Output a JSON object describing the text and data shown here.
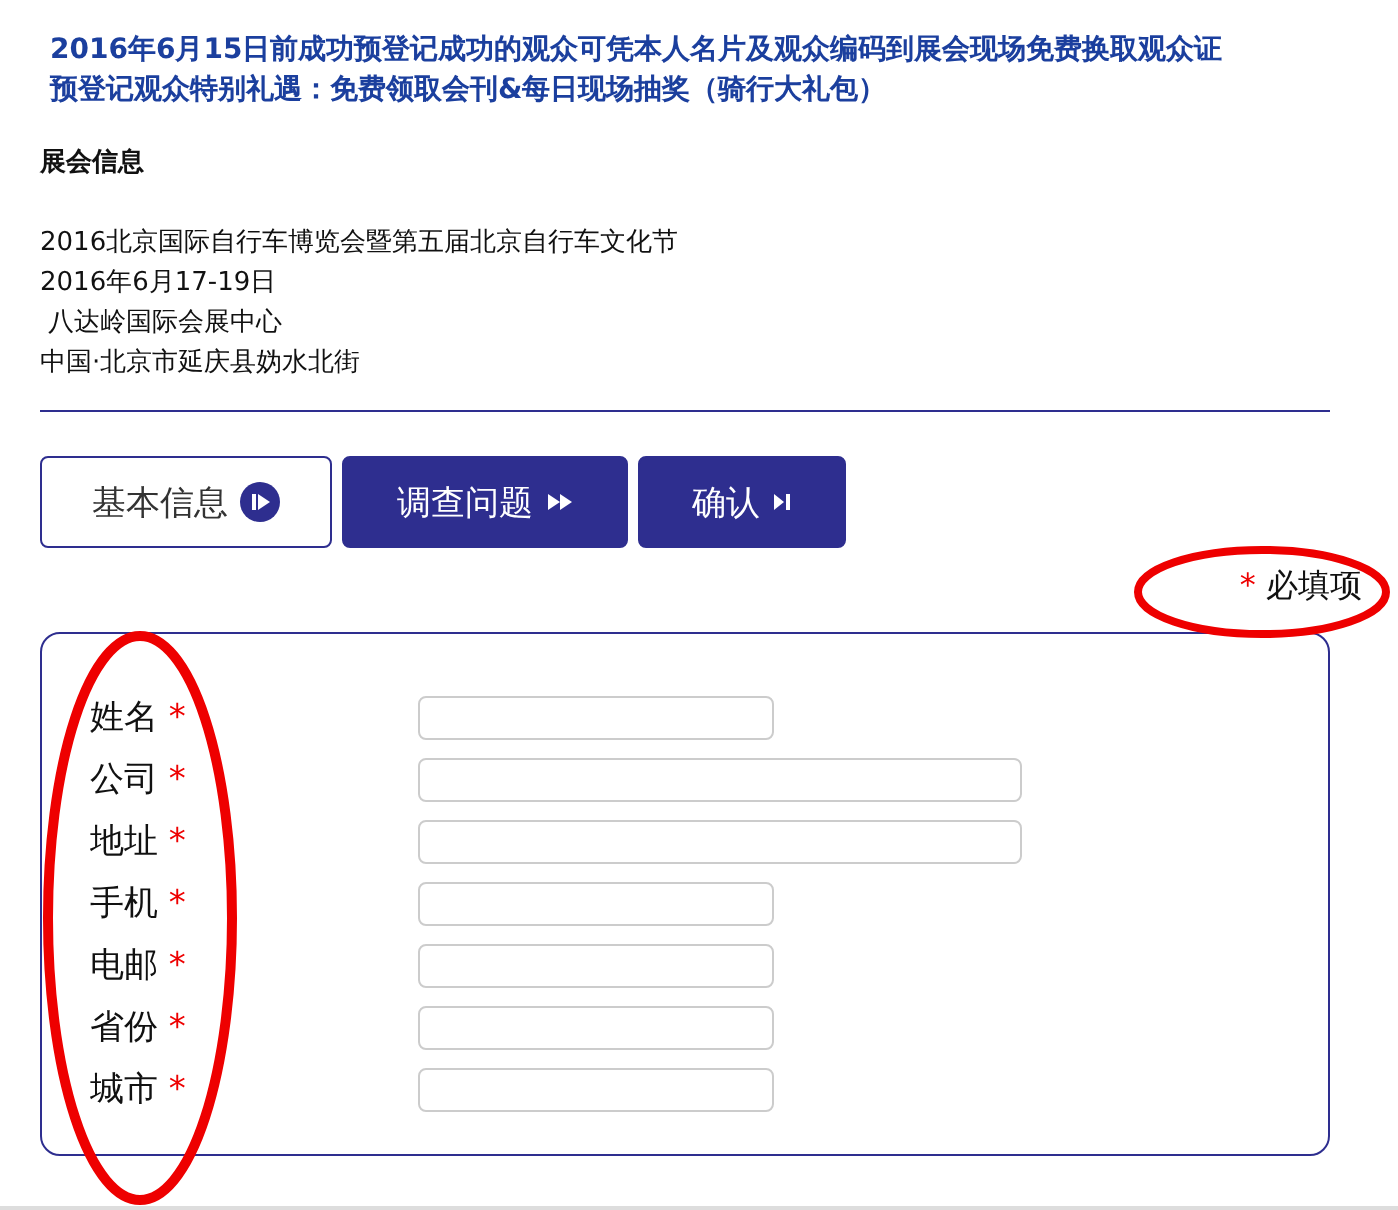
{
  "notice": [
    "2016年6月15日前成功预登记成功的观众可凭本人名片及观众编码到展会现场免费换取观众证",
    "预登记观众特别礼遇：免费领取会刊&每日现场抽奖（骑行大礼包）"
  ],
  "info": {
    "heading": "展会信息",
    "lines": [
      "2016北京国际自行车博览会暨第五届北京自行车文化节",
      "2016年6月17-19日",
      " 八达岭国际会展中心",
      "中国·北京市延庆县妫水北街"
    ]
  },
  "steps": [
    {
      "label": "基本信息",
      "selected": true
    },
    {
      "label": "调查问题",
      "selected": false
    },
    {
      "label": "确认",
      "selected": false
    }
  ],
  "required_note": {
    "mark": "*",
    "text": "必填项"
  },
  "fields": [
    {
      "label": "姓名",
      "required": true,
      "kind": "short"
    },
    {
      "label": "公司",
      "required": true,
      "kind": "long"
    },
    {
      "label": "地址",
      "required": true,
      "kind": "long"
    },
    {
      "label": "手机",
      "required": true,
      "kind": "short"
    },
    {
      "label": "电邮",
      "required": true,
      "kind": "short"
    },
    {
      "label": "省份",
      "required": true,
      "kind": "short"
    },
    {
      "label": "城市",
      "required": true,
      "kind": "short"
    }
  ]
}
